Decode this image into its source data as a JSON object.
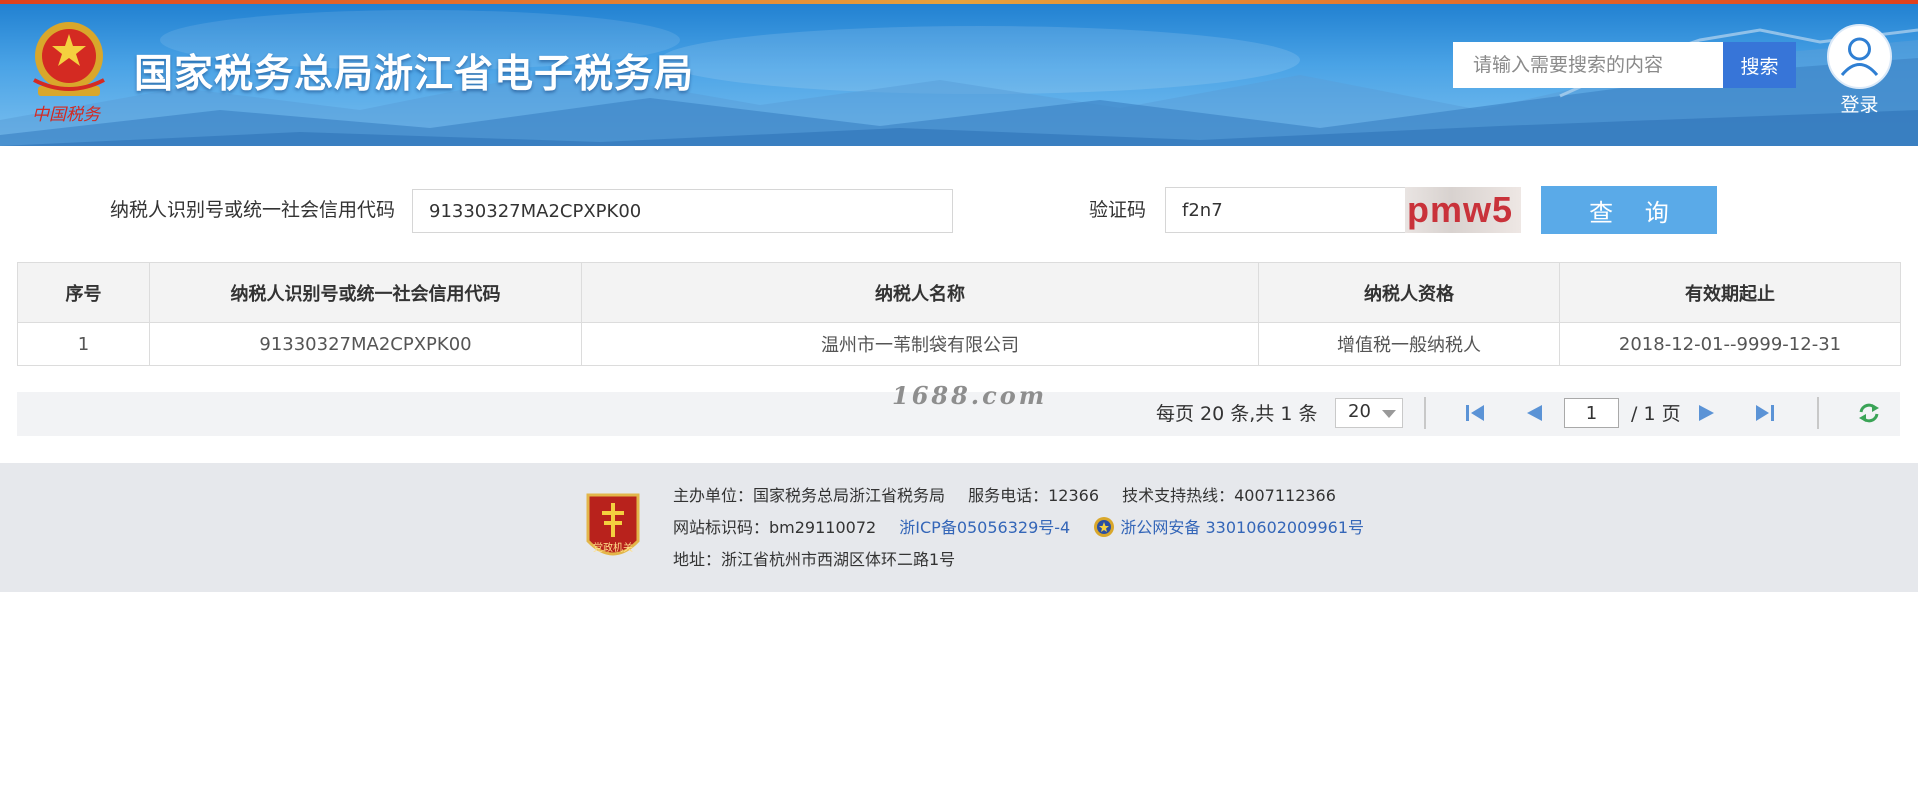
{
  "header": {
    "site_title": "国家税务总局浙江省电子税务局",
    "search_placeholder": "请输入需要搜索的内容",
    "search_label": "搜索",
    "login_label": "登录"
  },
  "query_form": {
    "taxpayer_id_label": "纳税人识别号或统一社会信用代码",
    "taxpayer_id_value": "91330327MA2CPXPK00",
    "captcha_label": "验证码",
    "captcha_value": "f2n7",
    "captcha_image_text": "pmw5",
    "query_label": "查 询"
  },
  "table": {
    "columns": [
      "序号",
      "纳税人识别号或统一社会信用代码",
      "纳税人名称",
      "纳税人资格",
      "有效期起止"
    ],
    "rows": [
      [
        "1",
        "91330327MA2CPXPK00",
        "温州市一苇制袋有限公司",
        "增值税一般纳税人",
        "2018-12-01--9999-12-31"
      ]
    ]
  },
  "pager": {
    "summary": "每页 20 条,共 1 条",
    "page_size": "20",
    "current_page": "1",
    "total_pages": "/ 1 页",
    "icons": [
      "first-page-icon",
      "prev-page-icon",
      "next-page-icon",
      "last-page-icon",
      "refresh-icon"
    ]
  },
  "watermark": "1688.com",
  "footer": {
    "host_unit": "主办单位：国家税务总局浙江省税务局",
    "service_phone": "服务电话：12366",
    "support_hotline": "技术支持热线：4007112366",
    "site_code": "网站标识码：bm29110072",
    "icp": "浙ICP备05056329号-4",
    "police_record": "浙公网安备 33010602009961号",
    "address": "地址：浙江省杭州市西湖区体环二路1号",
    "badge_text": "党政机关"
  },
  "colors": {
    "search_button": "#3775d8",
    "query_button": "#5aaae8",
    "captcha_text": "#c9323a",
    "footer_link": "#3466b8",
    "pager_icon": "#5b93d6",
    "refresh_icon": "#3aa356"
  }
}
